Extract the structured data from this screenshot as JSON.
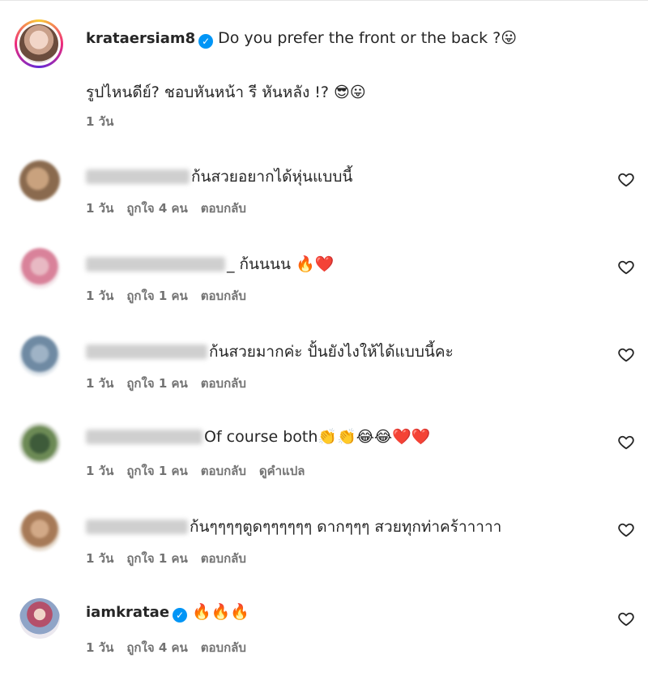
{
  "post": {
    "username": "krataersiam8",
    "caption_line1": "Do you prefer the front or the back ?😛",
    "caption_line2": "รูปไหนดีย์? ชอบหันหน้า รี หันหลัง !? 😎😛",
    "time": "1 วัน"
  },
  "comments": [
    {
      "text": "ก้นสวยอยากได้หุ่นแบบนี้",
      "time": "1 วัน",
      "likes": "ถูกใจ 4 คน",
      "reply": "ตอบกลับ"
    },
    {
      "text": "_ ก้นนนน 🔥❤️",
      "time": "1 วัน",
      "likes": "ถูกใจ 1 คน",
      "reply": "ตอบกลับ"
    },
    {
      "text": "ก้นสวยมากค่ะ ปั้นยังไงให้ได้แบบนี้คะ",
      "time": "1 วัน",
      "likes": "ถูกใจ 1 คน",
      "reply": "ตอบกลับ"
    },
    {
      "text": "Of course both👏👏😂😂❤️❤️",
      "time": "1 วัน",
      "likes": "ถูกใจ 1 คน",
      "reply": "ตอบกลับ",
      "translate": "ดูคำแปล"
    },
    {
      "text": "ก้นๆๆๆๆตูดๆๆๆๆๆๆ ดากๆๆๆ สวยทุกท่าคร้าาาาา",
      "time": "1 วัน",
      "likes": "ถูกใจ 1 คน",
      "reply": "ตอบกลับ"
    },
    {
      "username": "iamkratae",
      "text": "🔥🔥🔥",
      "time": "1 วัน",
      "likes": "ถูกใจ 4 คน",
      "reply": "ตอบกลับ"
    }
  ],
  "icons": {
    "verified": "verified-badge-icon",
    "like": "heart-outline-icon"
  },
  "colors": {
    "verified": "#0095f6",
    "meta": "#737373",
    "text": "#262626"
  }
}
